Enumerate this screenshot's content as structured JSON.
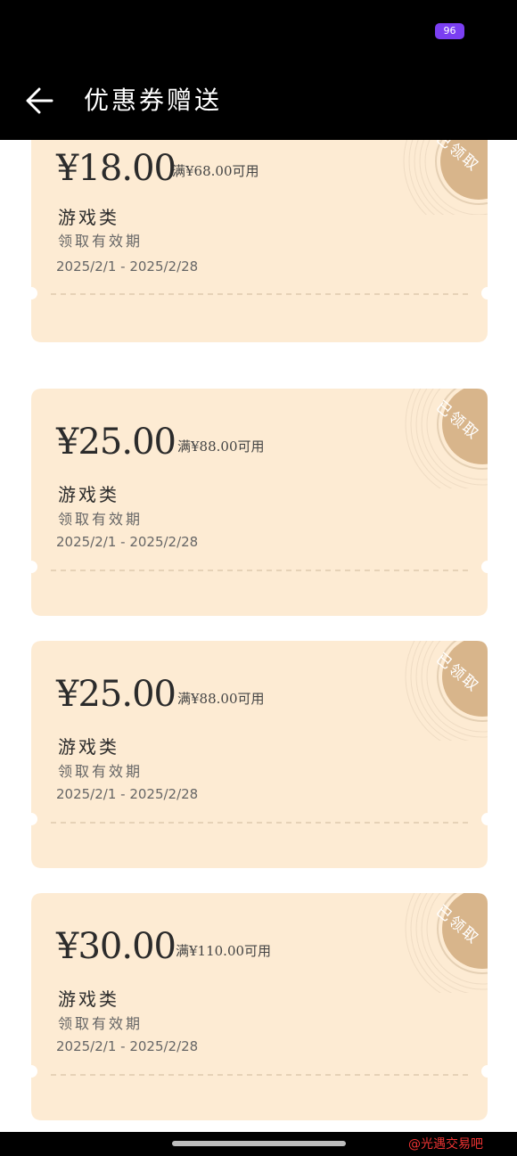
{
  "status_bar": {
    "battery": "96"
  },
  "header": {
    "title": "优惠券赠送"
  },
  "coupons": [
    {
      "amount": "¥18.00",
      "condition": "满¥68.00可用",
      "category": "游戏类",
      "validity_label": "领取有效期",
      "validity_dates": "2025/2/1 - 2025/2/28",
      "stamp": "已领取"
    },
    {
      "amount": "¥25.00",
      "condition": "满¥88.00可用",
      "category": "游戏类",
      "validity_label": "领取有效期",
      "validity_dates": "2025/2/1 - 2025/2/28",
      "stamp": "已领取"
    },
    {
      "amount": "¥25.00",
      "condition": "满¥88.00可用",
      "category": "游戏类",
      "validity_label": "领取有效期",
      "validity_dates": "2025/2/1 - 2025/2/28",
      "stamp": "已领取"
    },
    {
      "amount": "¥30.00",
      "condition": "满¥110.00可用",
      "category": "游戏类",
      "validity_label": "领取有效期",
      "validity_dates": "2025/2/1 - 2025/2/28",
      "stamp": "已领取"
    }
  ],
  "watermark": "@光遇交易吧",
  "colors": {
    "coupon_bg": "#fdebd3",
    "stamp": "#d8b58b",
    "header_bg": "#000000",
    "battery": "#7b3ff2"
  }
}
